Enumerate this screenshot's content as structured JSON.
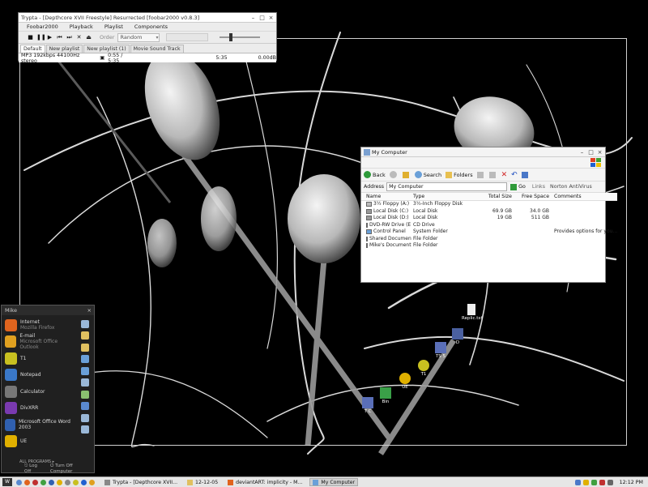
{
  "colors": {
    "desktop_bg": "#000000",
    "taskbar_bg": "#e6e6e6",
    "startmenu_bg": "#202020"
  },
  "foobar": {
    "title": "Trypta - [Depthcore XVII Freestyle] Resurrected   [foobar2000 v0.8.3]",
    "menu": [
      "Foobar2000",
      "Playback",
      "Playlist",
      "Components"
    ],
    "order_label": "Order",
    "order_value": "Random",
    "tabs": [
      "Default",
      "New playlist",
      "New playlist (1)",
      "Movie Sound Track"
    ],
    "status_text": "MP3 192kbps 44100Hz stereo",
    "status_pos": "0:55 / 5:35",
    "status_len": "5:35",
    "status_gain": "0.00dB"
  },
  "explorer": {
    "title": "My Computer",
    "toolbar": {
      "back": "Back",
      "search": "Search",
      "folders": "Folders"
    },
    "address_label": "Address",
    "address_value": "My Computer",
    "go": "Go",
    "links": "Links",
    "norton": "Norton AntiVirus",
    "columns": [
      "Name",
      "Type",
      "Total Size",
      "Free Space",
      "Comments"
    ],
    "rows": [
      {
        "name": "3½ Floppy (A:)",
        "type": "3½-Inch Floppy Disk",
        "total": "",
        "free": "",
        "comment": ""
      },
      {
        "name": "Local Disk (C:)",
        "type": "Local Disk",
        "total": "69.9 GB",
        "free": "34.0 GB",
        "comment": ""
      },
      {
        "name": "Local Disk (D:)",
        "type": "Local Disk",
        "total": "19 GB",
        "free": "511 GB",
        "comment": ""
      },
      {
        "name": "DVD-RW Drive (E:)",
        "type": "CD Drive",
        "total": "",
        "free": "",
        "comment": ""
      },
      {
        "name": "Control Panel",
        "type": "System Folder",
        "total": "",
        "free": "",
        "comment": "Provides options for you..."
      },
      {
        "name": "Shared Documents",
        "type": "File Folder",
        "total": "",
        "free": "",
        "comment": ""
      },
      {
        "name": "Mike's Documents",
        "type": "File Folder",
        "total": "",
        "free": "",
        "comment": ""
      }
    ]
  },
  "startmenu": {
    "user": "Mike",
    "items": [
      {
        "label": "Internet",
        "sub": "Mozilla Firefox",
        "color": "#e0641e"
      },
      {
        "label": "E-mail",
        "sub": "Microsoft Office Outlook",
        "color": "#e0a020"
      },
      {
        "label": "T1",
        "sub": "",
        "color": "#c8c020"
      },
      {
        "label": "Notepad",
        "sub": "",
        "color": "#3a78c8"
      },
      {
        "label": "Calculator",
        "sub": "",
        "color": "#777777"
      },
      {
        "label": "DivXRR",
        "sub": "",
        "color": "#7a3ab0"
      },
      {
        "label": "Microsoft Office Word 2003",
        "sub": "",
        "color": "#3060b0"
      },
      {
        "label": "UE",
        "sub": "",
        "color": "#e0b000"
      }
    ],
    "all_programs": "ALL PROGRAMS",
    "logoff": "Log Off",
    "turnoff": "Turn Off Computer"
  },
  "desktop_icons": [
    {
      "label": "Replic.txt"
    },
    {
      "label": "D"
    },
    {
      "label": "TS 5"
    },
    {
      "label": "T1"
    },
    {
      "label": "UE"
    },
    {
      "label": "Bin"
    },
    {
      "label": "T C"
    }
  ],
  "taskbar": {
    "start": "W",
    "tasks": [
      {
        "label": "Trypta - [Depthcore XVII...",
        "active": false
      },
      {
        "label": "12-12-05",
        "active": false
      },
      {
        "label": "deviantART: implicity - M...",
        "active": false
      },
      {
        "label": "My Computer",
        "active": true
      }
    ],
    "clock": "12:12 PM"
  }
}
